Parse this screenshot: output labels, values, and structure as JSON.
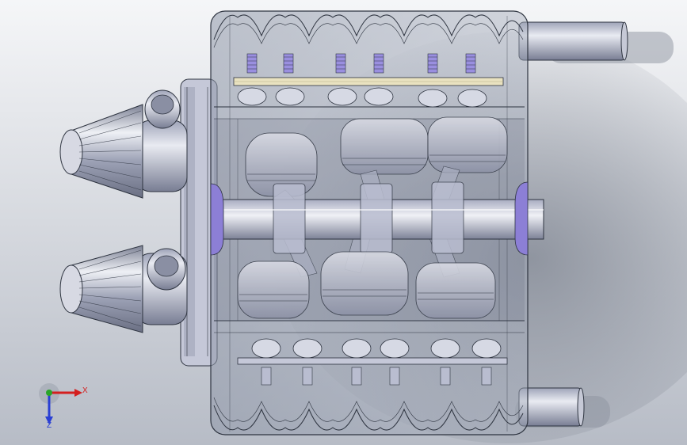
{
  "scene": {
    "background_top": "#f5f6f8",
    "background_bottom": "#b7bcc6",
    "shadow_color": "#8a909b",
    "edge_color": "#2e3440",
    "transparent_body": "#8f97a8",
    "metal_light": "#e4e6ee",
    "metal_mid": "#b9bdd0",
    "metal_dark": "#6e7388",
    "bearing_color": "#8c7fd6",
    "rail_color": "#e9e2c0"
  },
  "triad": {
    "x_label": "X",
    "y_label": "",
    "z_label": "Z",
    "x_color": "#d41f1f",
    "y_color": "#2aa52a",
    "z_color": "#2a3fd4"
  }
}
